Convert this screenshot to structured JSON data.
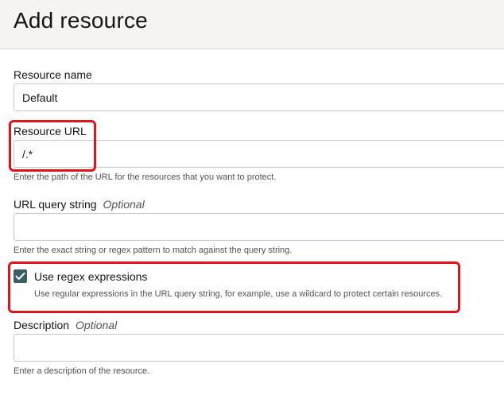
{
  "dialog": {
    "title": "Add resource"
  },
  "resource_name": {
    "label": "Resource name",
    "value": "Default"
  },
  "resource_url": {
    "label": "Resource URL",
    "value": "/.*",
    "help": "Enter the path of the URL for the resources that you want to protect."
  },
  "url_query_string": {
    "label": "URL query string",
    "optional": "Optional",
    "value": "",
    "help": "Enter the exact string or regex pattern to match against the query string."
  },
  "regex": {
    "label": "Use regex expressions",
    "checked": true,
    "help": "Use regular expressions in the URL query string, for example, use a wildcard to protect certain resources."
  },
  "description": {
    "label": "Description",
    "optional": "Optional",
    "value": "",
    "help": "Enter a description of the resource."
  },
  "colors": {
    "highlight": "#e0141b",
    "checkbox": "#3a5f6b",
    "header_bg": "#f5f4f2"
  }
}
